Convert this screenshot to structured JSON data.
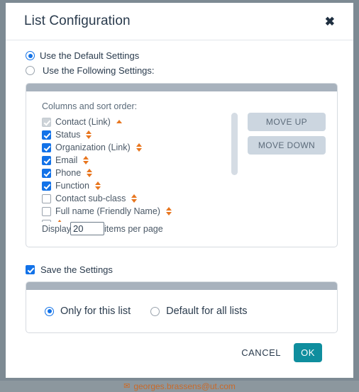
{
  "background": {
    "mail_icon": "envelope-icon",
    "mail_text": "georges.brassens@ut.com"
  },
  "modal": {
    "title": "List Configuration",
    "close_label": "✖"
  },
  "settings_mode": {
    "options": [
      {
        "label": "Use the Default Settings",
        "selected": true
      },
      {
        "label": "Use the Following Settings:",
        "selected": false
      }
    ]
  },
  "columns_panel": {
    "caption": "Columns and sort order:",
    "items": [
      {
        "label": "Contact (Link)",
        "checked": true,
        "disabled": true,
        "sort": "up"
      },
      {
        "label": "Status",
        "checked": true,
        "disabled": false,
        "sort": "both"
      },
      {
        "label": "Organization (Link)",
        "checked": true,
        "disabled": false,
        "sort": "both"
      },
      {
        "label": "Email",
        "checked": true,
        "disabled": false,
        "sort": "both"
      },
      {
        "label": "Phone",
        "checked": true,
        "disabled": false,
        "sort": "both"
      },
      {
        "label": "Function",
        "checked": true,
        "disabled": false,
        "sort": "both"
      },
      {
        "label": "Contact sub-class",
        "checked": false,
        "disabled": false,
        "sort": "both"
      },
      {
        "label": "Full name (Friendly Name)",
        "checked": false,
        "disabled": false,
        "sort": "both"
      }
    ],
    "display_prefix": "Display",
    "display_value": "20",
    "display_suffix": "items per page",
    "move_up_label": "MOVE UP",
    "move_down_label": "MOVE DOWN",
    "scrollbar": "vertical-scrollbar"
  },
  "save_settings": {
    "label": "Save the Settings",
    "checked": true
  },
  "scope": {
    "options": [
      {
        "label": "Only for this list",
        "selected": true
      },
      {
        "label": "Default for all lists",
        "selected": false
      }
    ]
  },
  "footer": {
    "cancel_label": "CANCEL",
    "ok_label": "OK"
  },
  "colors": {
    "accent_blue": "#1272e8",
    "ok_teal": "#0f8e9e",
    "sort_orange": "#e8761f",
    "panel_header_gray": "#a8b2bd",
    "move_button_gray": "#ccd6e0"
  }
}
